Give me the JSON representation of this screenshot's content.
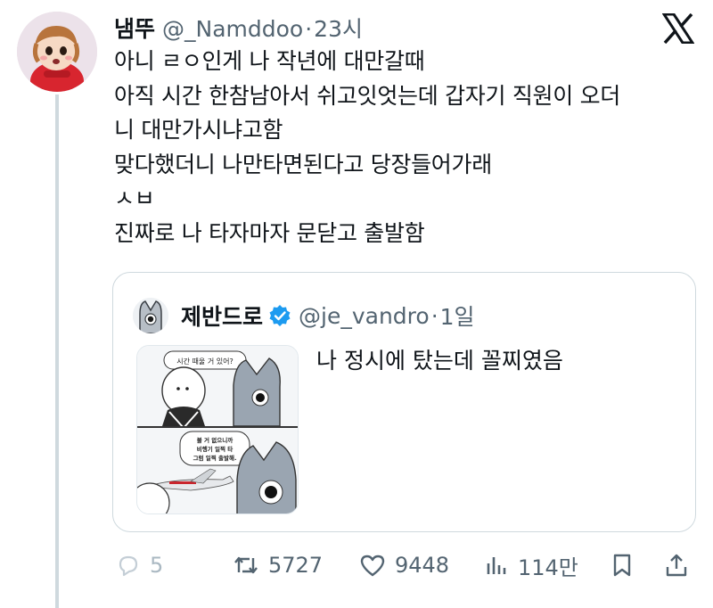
{
  "author": {
    "display_name": "냄뚜",
    "handle": "@_Namddoo",
    "timestamp": "23시"
  },
  "tweet": {
    "lines": [
      "아니 ㄹㅇ인게 나 작년에 대만갈때",
      "아직 시간 한참남아서 쉬고잇엇는데 갑자기 직원이 오더",
      "니 대만가시냐고함",
      "맞다했더니 나만타면된다고 당장들어가래",
      "ㅅㅂ",
      "진짜로 나 타자마자 문닫고 출발함"
    ]
  },
  "quote": {
    "display_name": "제반드로",
    "handle": "@je_vandro",
    "timestamp": "1일",
    "text": "나 정시에 탔는데 꼴찌였음",
    "media": {
      "bubble_top": "시간 때울 거 있어?",
      "bubble_bottom_1": "볼 거 없으니까",
      "bubble_bottom_2": "비행기 일찍 타",
      "bubble_bottom_3": "그럼 일찍 출발해."
    }
  },
  "actions": {
    "replies": "5",
    "reposts": "5727",
    "likes": "9448",
    "views": "114만"
  },
  "icons": {
    "brand": "x-logo-icon",
    "verified": "verified-badge-icon",
    "reply": "reply-icon",
    "repost": "repost-icon",
    "like": "heart-icon",
    "views": "views-icon",
    "bookmark": "bookmark-icon",
    "share": "share-icon"
  },
  "colors": {
    "text_primary": "#0f1419",
    "text_secondary": "#536471",
    "border": "#cfd9de",
    "verified_blue": "#1d9bf0"
  }
}
